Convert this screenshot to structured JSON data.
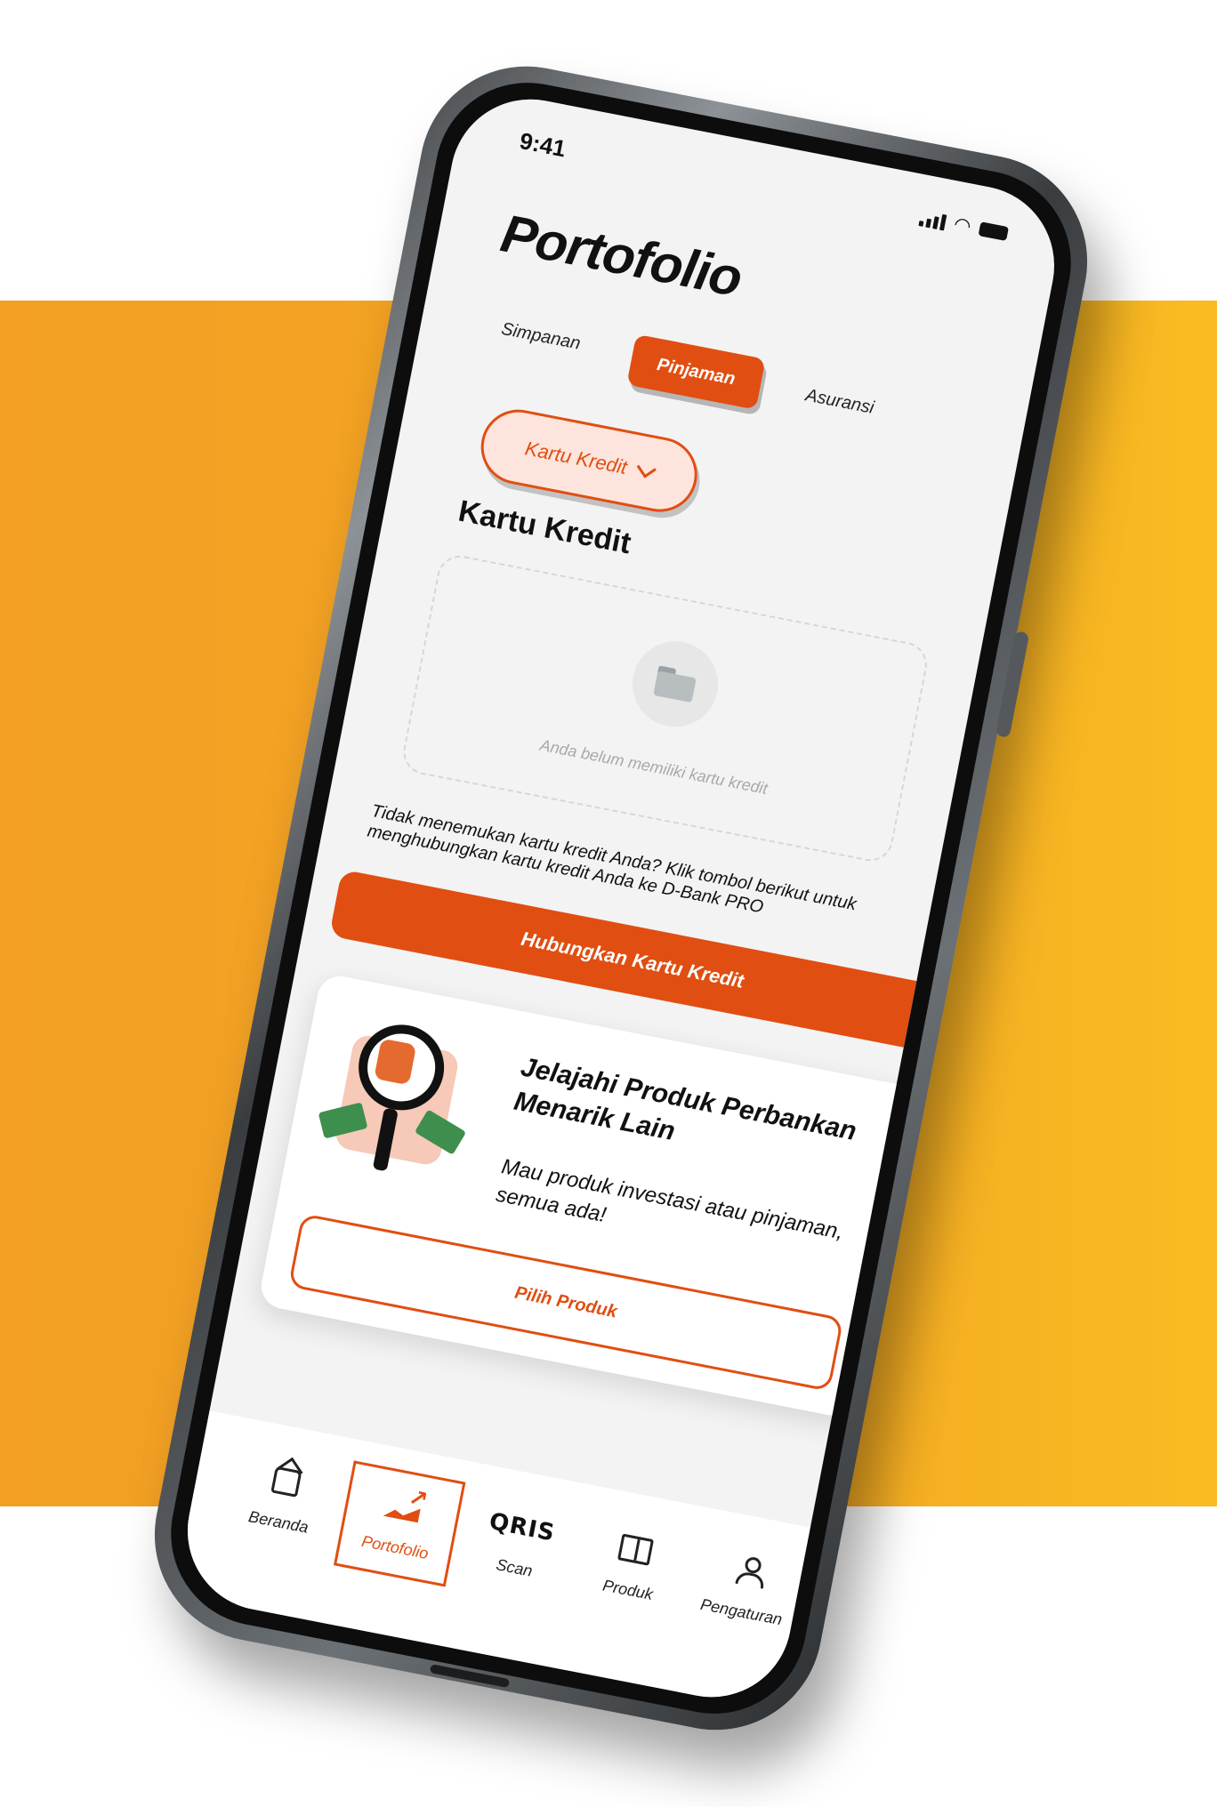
{
  "status_bar": {
    "time": "9:41",
    "icons": [
      "signal-icon",
      "wifi-icon",
      "battery-icon"
    ]
  },
  "header": {
    "title": "Portofolio"
  },
  "tabs": [
    {
      "label": "Simpanan",
      "active": false
    },
    {
      "label": "Pinjaman",
      "active": true
    },
    {
      "label": "Asuransi",
      "active": false
    }
  ],
  "filter": {
    "selected": "Kartu Kredit",
    "icon": "chevron-down-icon"
  },
  "section": {
    "title": "Kartu Kredit",
    "empty_state": {
      "icon": "folder-icon",
      "text": "Anda belum memiliki kartu kredit"
    }
  },
  "helper": {
    "text": "Tidak menemukan kartu kredit Anda? Klik tombol berikut untuk menghubungkan kartu kredit Anda ke D-Bank PRO"
  },
  "primary_action": {
    "label": "Hubungkan Kartu Kredit"
  },
  "promo": {
    "title": "Jelajahi Produk Perbankan Menarik Lain",
    "description": "Mau produk investasi atau pinjaman, semua ada!",
    "button_label": "Pilih Produk"
  },
  "bottom_nav": [
    {
      "label": "Beranda",
      "icon": "home-icon",
      "active": false
    },
    {
      "label": "Portofolio",
      "icon": "portfolio-chart-icon",
      "active": true
    },
    {
      "label": "Scan",
      "icon": "qris-icon",
      "icon_text": "QRIS",
      "active": false
    },
    {
      "label": "Produk",
      "icon": "book-icon",
      "active": false
    },
    {
      "label": "Pengaturan",
      "icon": "user-settings-icon",
      "active": false
    }
  ],
  "colors": {
    "accent": "#e04e12",
    "background_band": "#f4a623",
    "screen": "#f3f3f3"
  }
}
